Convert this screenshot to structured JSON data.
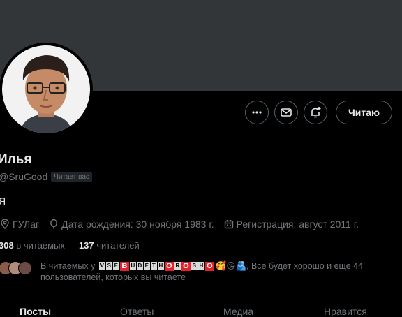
{
  "profile": {
    "name": "Илья",
    "handle": "@SruGood",
    "follows_you": "Читает вас",
    "bio": "Я",
    "location": "ГУЛаг",
    "birthday": "Дата рождения: 30 ноября 1983 г.",
    "joined": "Регистрация: август 2011 г."
  },
  "counts": {
    "following_num": "308",
    "following_label": "в читаемых",
    "followers_num": "137",
    "followers_label": "читателей"
  },
  "followed_by": {
    "prefix": "В читаемых у",
    "nick_letters": [
      "V",
      "S",
      "E",
      "B",
      "U",
      "D",
      "E",
      "T",
      "H",
      "O",
      "R",
      "O",
      "S",
      "H",
      "O"
    ],
    "nick_emoji": "🥰😘🫂",
    "suffix": ", Все будет хорошо и еще 44 пользователей, которых вы читаете"
  },
  "actions": {
    "follow_label": "Читаю"
  },
  "tabs": [
    "Посты",
    "Ответы",
    "Медиа",
    "Нравится"
  ],
  "colors": {
    "banner": "#333639",
    "background": "#000000",
    "muted": "#71767b"
  }
}
